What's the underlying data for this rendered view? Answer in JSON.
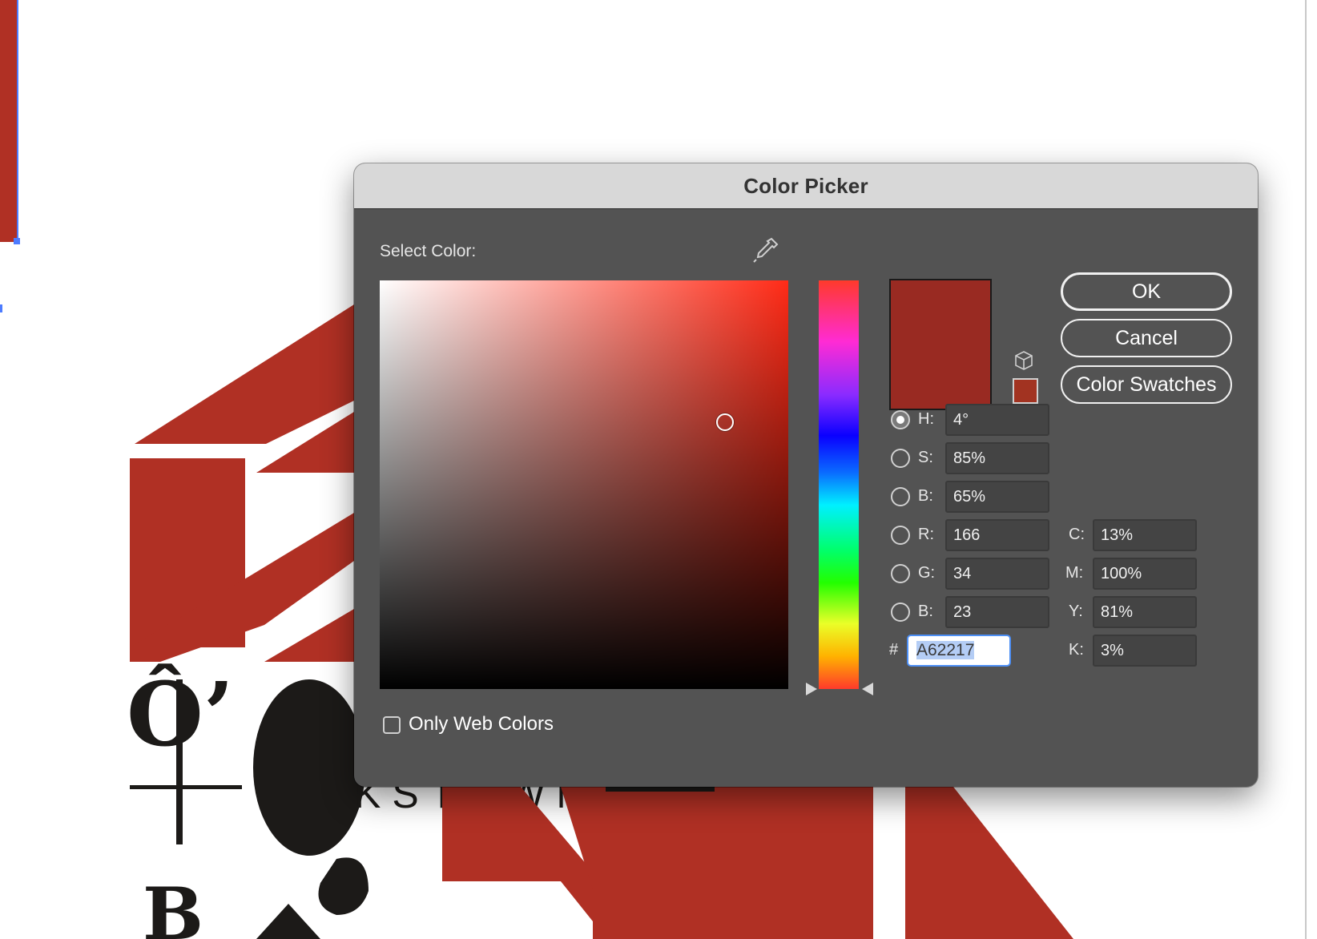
{
  "dialog": {
    "title": "Color Picker",
    "select_color_label": "Select Color:",
    "eyedropper_icon": "eyedropper-icon",
    "buttons": {
      "ok": "OK",
      "cancel": "Cancel",
      "swatches": "Color Swatches"
    },
    "hsb": {
      "h_label": "H:",
      "h_value": "4°",
      "s_label": "S:",
      "s_value": "85%",
      "b_label": "B:",
      "b_value": "65%"
    },
    "rgb": {
      "r_label": "R:",
      "r_value": "166",
      "g_label": "G:",
      "g_value": "34",
      "b_label": "B:",
      "b_value": "23"
    },
    "cmyk": {
      "c_label": "C:",
      "c_value": "13%",
      "m_label": "M:",
      "m_value": "100%",
      "y_label": "Y:",
      "y_value": "81%",
      "k_label": "K:",
      "k_value": "3%"
    },
    "hex_label": "#",
    "hex_value": "A62217",
    "web_colors_label": "Only Web Colors",
    "selected_mode": "H",
    "colors": {
      "new": "#992a22",
      "web_safe": "#a23321",
      "accent": "#4d8ff5"
    }
  },
  "background_art": {
    "brand_color": "#b03024",
    "text_fragments": [
      "Ô’",
      "KSTOWN",
      "B"
    ]
  }
}
